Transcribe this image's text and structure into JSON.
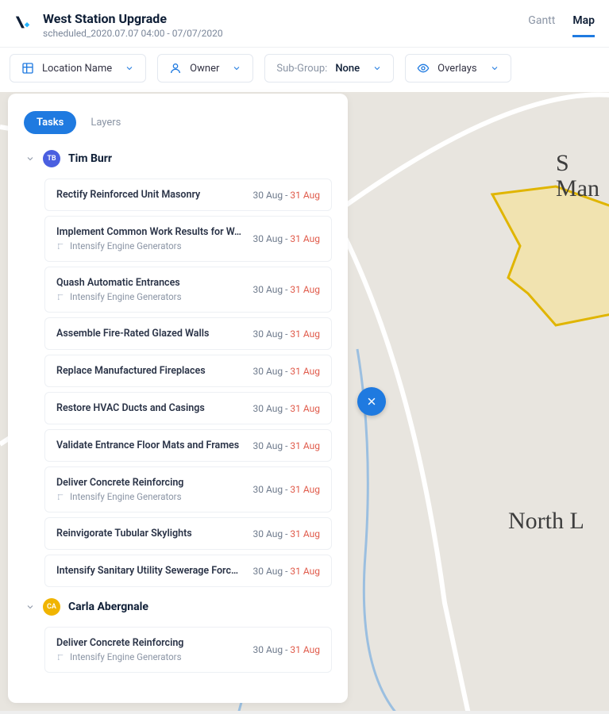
{
  "header": {
    "title": "West Station Upgrade",
    "subtitle": "scheduled_2020.07.07 04:00 - 07/07/2020",
    "tabs": {
      "gantt": "Gantt",
      "map": "Map"
    }
  },
  "filters": {
    "location": "Location Name",
    "owner": "Owner",
    "subgroup_label": "Sub-Group:",
    "subgroup_value": "None",
    "overlays": "Overlays"
  },
  "panel": {
    "tabs": {
      "tasks": "Tasks",
      "layers": "Layers"
    }
  },
  "map": {
    "labels": {
      "north": "North L",
      "sman": "S\nMan"
    }
  },
  "groups": [
    {
      "initials": "TB",
      "name": "Tim Burr",
      "color": "blue",
      "tasks": [
        {
          "title": "Rectify Reinforced Unit Masonry",
          "start": "30 Aug",
          "end": "31 Aug"
        },
        {
          "title": "Implement Common Work Results for W…",
          "sub": "Intensify Engine Generators",
          "start": "30 Aug",
          "end": "31 Aug"
        },
        {
          "title": "Quash Automatic Entrances",
          "sub": "Intensify Engine Generators",
          "start": "30 Aug",
          "end": "31 Aug"
        },
        {
          "title": "Assemble Fire-Rated Glazed Walls",
          "start": "30 Aug",
          "end": "31 Aug"
        },
        {
          "title": "Replace Manufactured Fireplaces",
          "start": "30 Aug",
          "end": "31 Aug"
        },
        {
          "title": "Restore HVAC Ducts and Casings",
          "start": "30 Aug",
          "end": "31 Aug"
        },
        {
          "title": "Validate Entrance Floor Mats and Frames",
          "start": "30 Aug",
          "end": "31 Aug"
        },
        {
          "title": "Deliver Concrete Reinforcing",
          "sub": "Intensify Engine Generators",
          "start": "30 Aug",
          "end": "31 Aug"
        },
        {
          "title": "Reinvigorate Tubular Skylights",
          "start": "30 Aug",
          "end": "31 Aug"
        },
        {
          "title": "Intensify Sanitary Utility Sewerage Forc…",
          "start": "30 Aug",
          "end": "31 Aug"
        }
      ]
    },
    {
      "initials": "CA",
      "name": "Carla Abergnale",
      "color": "yellow",
      "tasks": [
        {
          "title": "Deliver Concrete Reinforcing",
          "sub": "Intensify Engine Generators",
          "start": "30 Aug",
          "end": "31 Aug"
        }
      ]
    }
  ]
}
